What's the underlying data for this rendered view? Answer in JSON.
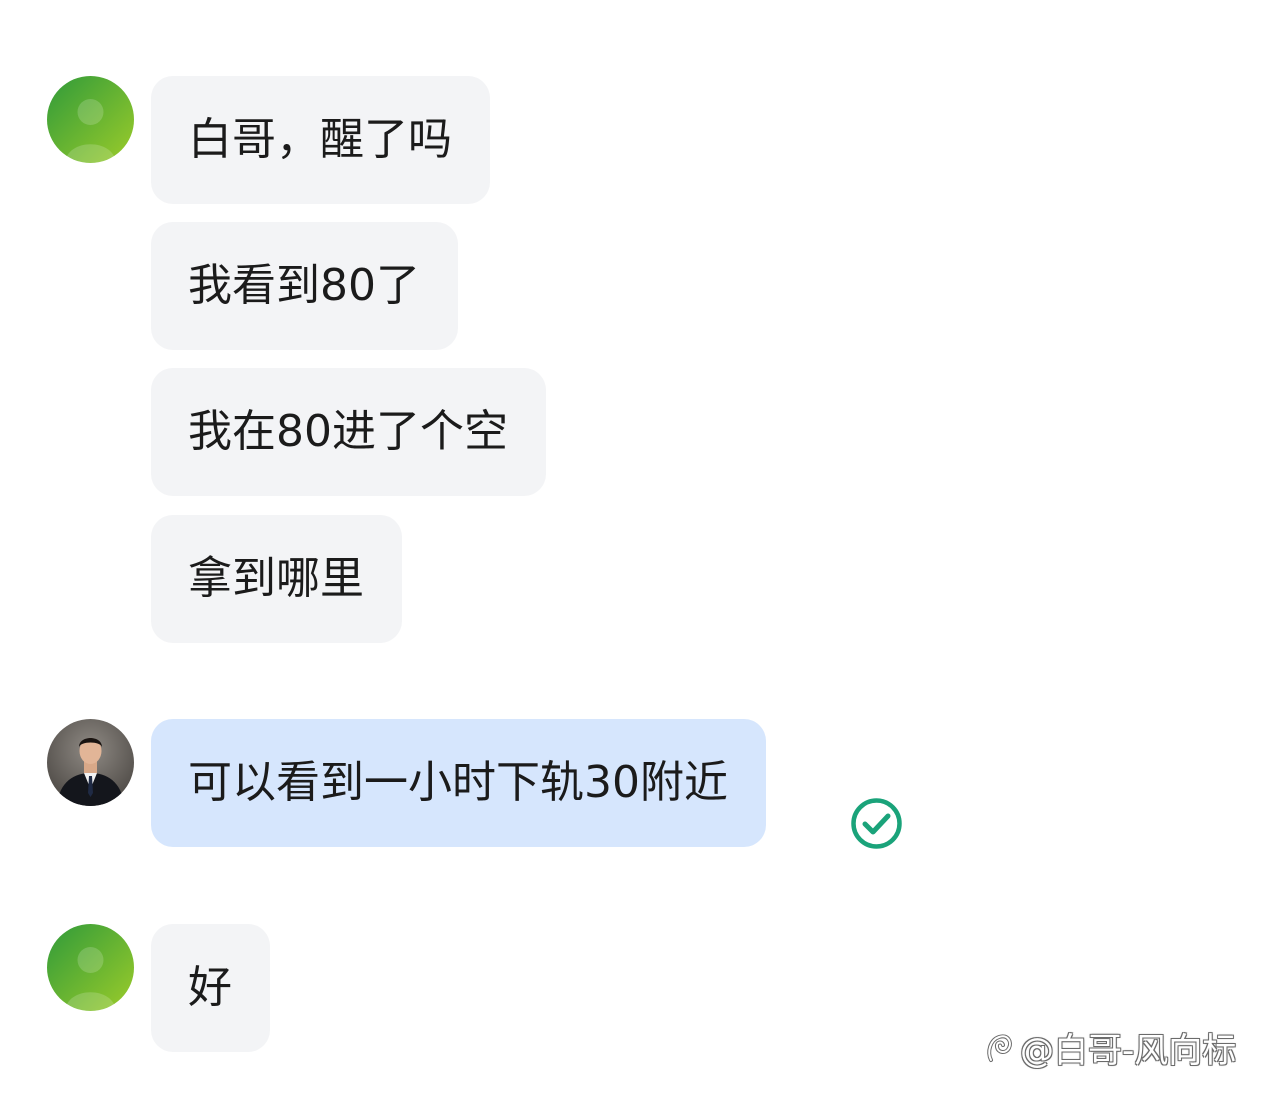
{
  "conversation": {
    "groups": [
      {
        "sender": "contact",
        "messages": [
          "白哥，醒了吗",
          "我看到80了",
          "我在80进了个空",
          "拿到哪里"
        ]
      },
      {
        "sender": "self",
        "messages": [
          "可以看到一小时下轨30附近"
        ],
        "status_icon": "read-check-icon"
      },
      {
        "sender": "contact",
        "messages": [
          "好"
        ]
      }
    ]
  },
  "watermark": {
    "text": "@白哥-风向标",
    "logo_icon": "platform-logo-icon"
  },
  "colors": {
    "incoming_bubble": "#f3f4f6",
    "outgoing_bubble": "#d6e6fd",
    "read_check": "#1aa37a",
    "contact_avatar": "#6cbf2a"
  }
}
